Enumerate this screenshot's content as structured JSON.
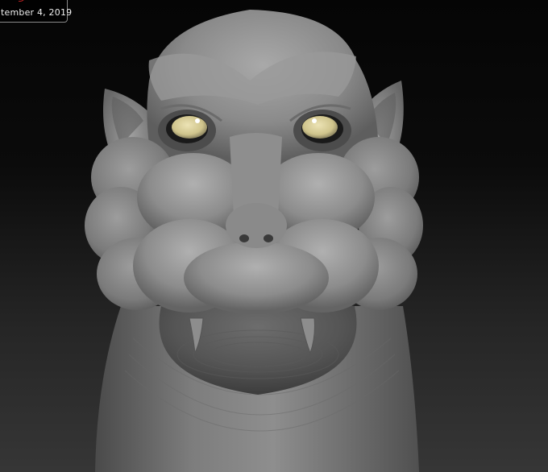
{
  "overlay": {
    "date_text": "tember 4, 2019"
  },
  "icons": {
    "mark": "red-corner-mark-icon"
  },
  "colors": {
    "background_top": "#050505",
    "background_bottom": "#363636",
    "clay": "#8f8f8f",
    "eye_iris": "#d8cf9a"
  }
}
